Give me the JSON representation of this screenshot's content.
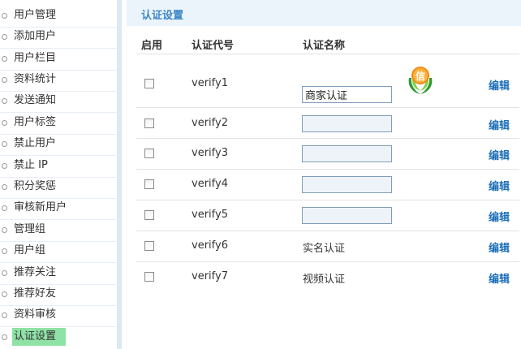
{
  "sidebar": {
    "items": [
      {
        "label": "用户管理"
      },
      {
        "label": "添加用户"
      },
      {
        "label": "用户栏目"
      },
      {
        "label": "资料统计"
      },
      {
        "label": "发送通知"
      },
      {
        "label": "用户标签"
      },
      {
        "label": "禁止用户"
      },
      {
        "label": "禁止 IP"
      },
      {
        "label": "积分奖惩"
      },
      {
        "label": "审核新用户"
      },
      {
        "label": "管理组"
      },
      {
        "label": "用户组"
      },
      {
        "label": "推荐关注"
      },
      {
        "label": "推荐好友"
      },
      {
        "label": "资料审核"
      },
      {
        "label": "认证设置",
        "active": true
      }
    ]
  },
  "main": {
    "title": "认证设置",
    "columns": {
      "enable": "启用",
      "code": "认证代号",
      "name": "认证名称"
    },
    "rows": [
      {
        "code": "verify1",
        "name": "商家认证",
        "editable": true,
        "has_badge": true,
        "badge_char": "信",
        "edit": "编辑"
      },
      {
        "code": "verify2",
        "name": "",
        "editable": true,
        "edit": "编辑"
      },
      {
        "code": "verify3",
        "name": "",
        "editable": true,
        "edit": "编辑"
      },
      {
        "code": "verify4",
        "name": "",
        "editable": true,
        "edit": "编辑"
      },
      {
        "code": "verify5",
        "name": "",
        "editable": true,
        "edit": "编辑"
      },
      {
        "code": "verify6",
        "name": "实名认证",
        "editable": false,
        "edit": "编辑"
      },
      {
        "code": "verify7",
        "name": "视频认证",
        "editable": false,
        "edit": "编辑"
      }
    ]
  },
  "colors": {
    "accent": "#3a86c7",
    "link": "#1d6fb8",
    "active_bg": "#8fe2a6",
    "header_bg": "#ecf4fb"
  }
}
